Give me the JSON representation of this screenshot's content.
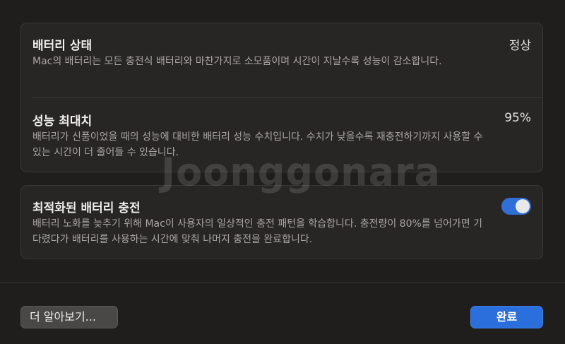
{
  "battery_health": {
    "title": "배터리 상태",
    "value": "정상",
    "description": "Mac의 배터리는 모든 충전식 배터리와 마찬가지로 소모품이며 시간이 지날수록 성능이 감소합니다."
  },
  "max_capacity": {
    "title": "성능 최대치",
    "value": "95%",
    "description": "배터리가 신품이었을 때의 성능에 대비한 배터리 성능 수치입니다. 수치가 낮을수록 재충전하기까지 사용할 수 있는 시간이 더 줄어들 수 있습니다."
  },
  "optimized_charging": {
    "title": "최적화된 배터리 충전",
    "enabled": true,
    "description": "배터리 노화를 늦추기 위해 Mac이 사용자의 일상적인 충전 패턴을 학습합니다. 충전량이 80%를 넘어가면 기다렸다가 배터리를 사용하는 시간에 맞춰 나머지 충전을 완료합니다."
  },
  "buttons": {
    "learn_more": "더 알아보기...",
    "done": "완료"
  },
  "watermark": "Joonggonara"
}
